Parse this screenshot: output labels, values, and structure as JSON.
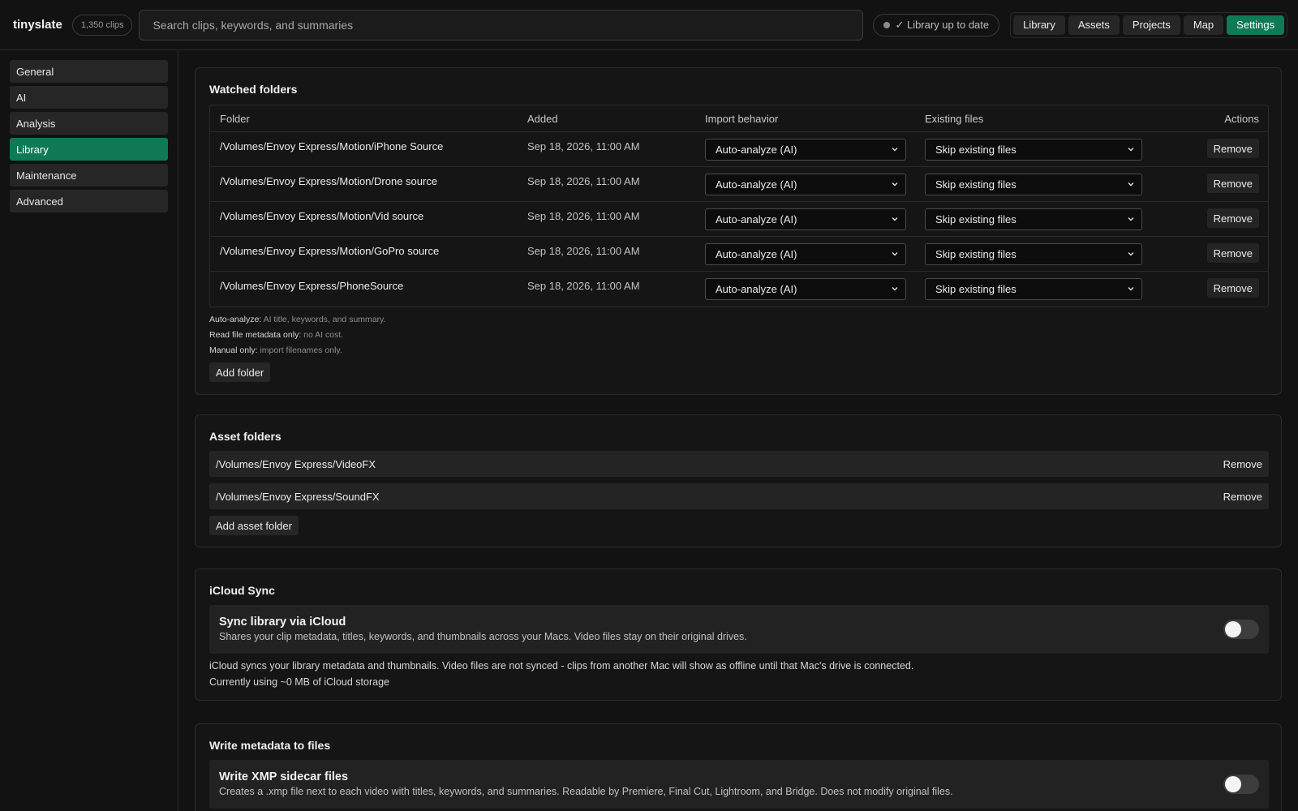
{
  "header": {
    "brand": "tinyslate",
    "clip_count": "1,350 clips",
    "search_placeholder": "Search clips, keywords, and summaries",
    "status": "✓ Library up to date",
    "nav": [
      {
        "label": "Library"
      },
      {
        "label": "Assets"
      },
      {
        "label": "Projects"
      },
      {
        "label": "Map"
      },
      {
        "label": "Settings"
      }
    ]
  },
  "sidebar": {
    "items": [
      {
        "label": "General"
      },
      {
        "label": "AI"
      },
      {
        "label": "Analysis"
      },
      {
        "label": "Library"
      },
      {
        "label": "Maintenance"
      },
      {
        "label": "Advanced"
      }
    ],
    "active": "Library"
  },
  "watched_folders": {
    "title": "Watched folders",
    "columns": [
      "Folder",
      "Added",
      "Import behavior",
      "Existing files",
      "Actions"
    ],
    "rows": [
      {
        "folder": "/Volumes/Envoy Express/Motion/iPhone Source",
        "added": "Sep 18, 2026, 11:00 AM",
        "import": "Auto-analyze (AI)",
        "existing": "Skip existing files",
        "action": "Remove"
      },
      {
        "folder": "/Volumes/Envoy Express/Motion/Drone source",
        "added": "Sep 18, 2026, 11:00 AM",
        "import": "Auto-analyze (AI)",
        "existing": "Skip existing files",
        "action": "Remove"
      },
      {
        "folder": "/Volumes/Envoy Express/Motion/Vid source",
        "added": "Sep 18, 2026, 11:00 AM",
        "import": "Auto-analyze (AI)",
        "existing": "Skip existing files",
        "action": "Remove"
      },
      {
        "folder": "/Volumes/Envoy Express/Motion/GoPro source",
        "added": "Sep 18, 2026, 11:00 AM",
        "import": "Auto-analyze (AI)",
        "existing": "Skip existing files",
        "action": "Remove"
      },
      {
        "folder": "/Volumes/Envoy Express/PhoneSource",
        "added": "Sep 18, 2026, 11:00 AM",
        "import": "Auto-analyze (AI)",
        "existing": "Skip existing files",
        "action": "Remove"
      }
    ],
    "notes": [
      {
        "label": "Auto-analyze:",
        "text": "AI title, keywords, and summary."
      },
      {
        "label": "Read file metadata only:",
        "text": "no AI cost."
      },
      {
        "label": "Manual only:",
        "text": "import filenames only."
      }
    ],
    "add_button": "Add folder"
  },
  "asset_folders": {
    "title": "Asset folders",
    "rows": [
      {
        "path": "/Volumes/Envoy Express/VideoFX",
        "action": "Remove"
      },
      {
        "path": "/Volumes/Envoy Express/SoundFX",
        "action": "Remove"
      }
    ],
    "add_button": "Add asset folder"
  },
  "icloud": {
    "title": "iCloud Sync",
    "toggle_title": "Sync library via iCloud",
    "toggle_desc": "Shares your clip metadata, titles, keywords, and thumbnails across your Macs. Video files stay on their original drives.",
    "toggle_on": false,
    "note": "iCloud syncs your library metadata and thumbnails. Video files are not synced - clips from another Mac will show as offline until that Mac's drive is connected.",
    "usage": "Currently using ~0 MB of iCloud storage"
  },
  "metadata": {
    "title": "Write metadata to files",
    "toggle_title": "Write XMP sidecar files",
    "toggle_desc": "Creates a .xmp file next to each video with titles, keywords, and summaries. Readable by Premiere, Final Cut, Lightroom, and Bridge. Does not modify original files.",
    "toggle_on": false
  },
  "colors": {
    "accent": "#0f7a55",
    "background": "#121212"
  }
}
